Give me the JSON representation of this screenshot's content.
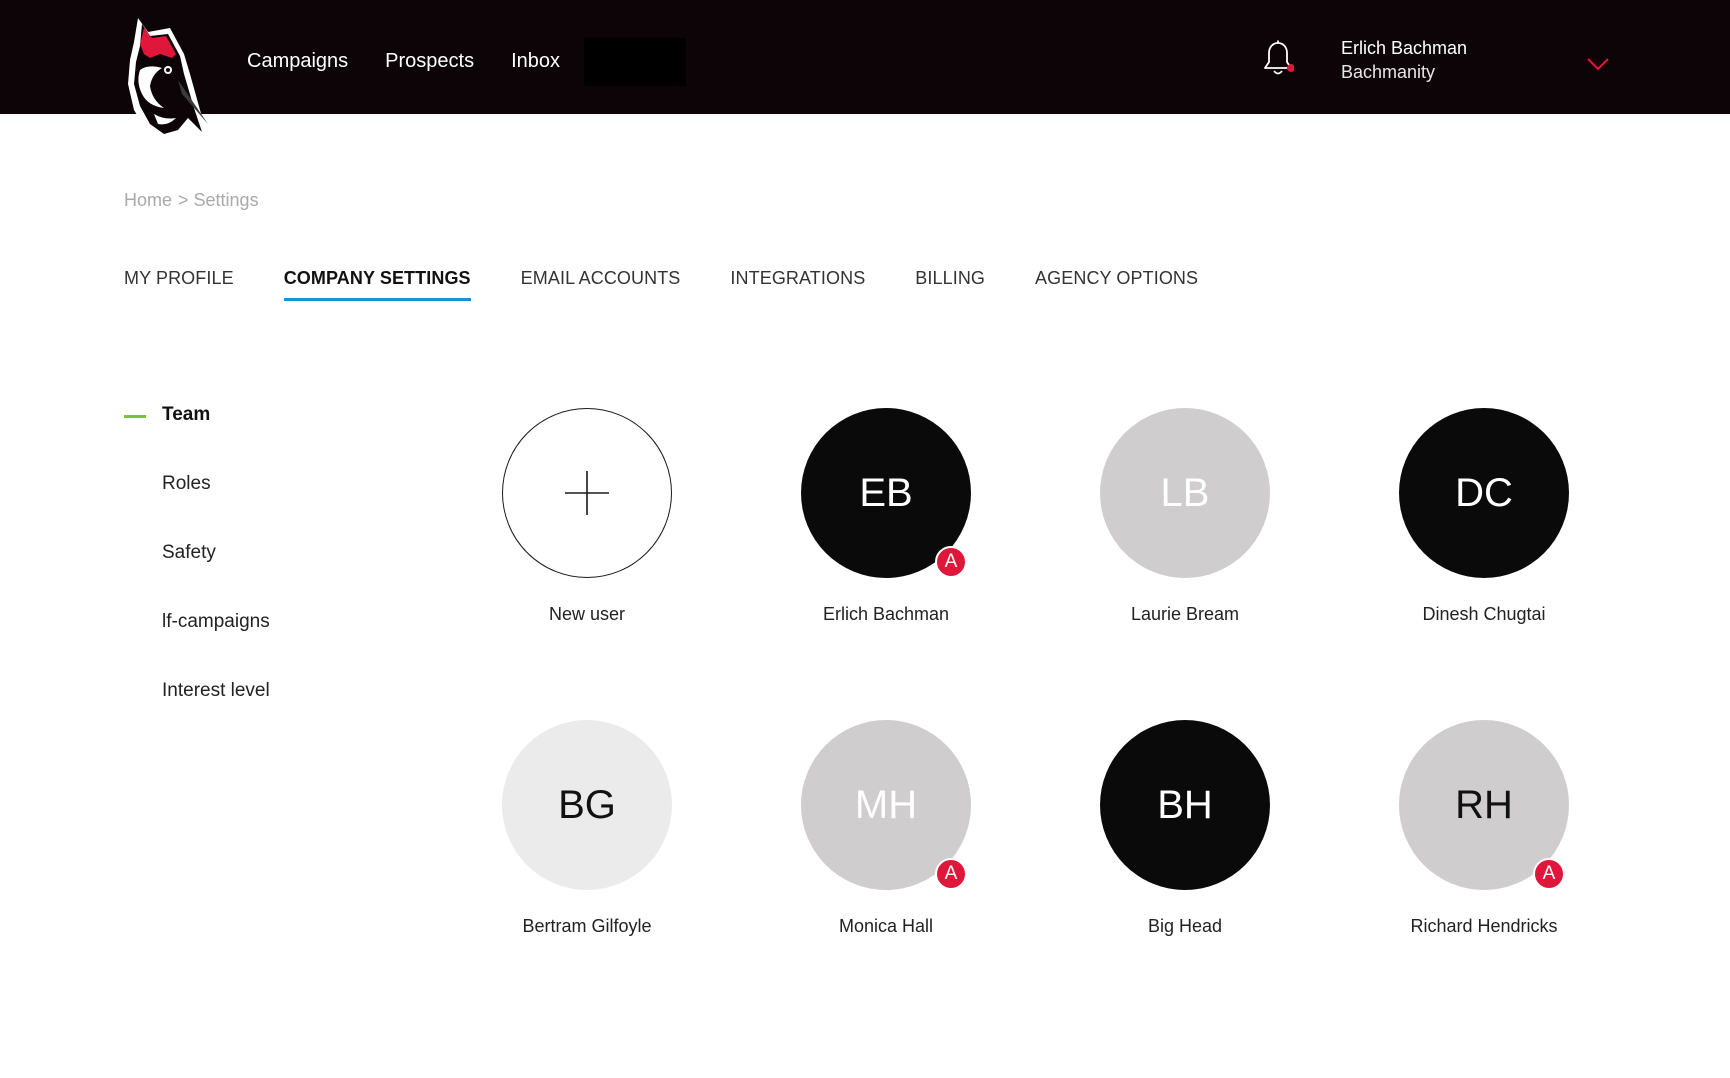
{
  "header": {
    "nav": [
      "Campaigns",
      "Prospects",
      "Inbox"
    ],
    "user_name": "Erlich Bachman",
    "user_org": "Bachmanity"
  },
  "breadcrumb": [
    "Home",
    "> Settings"
  ],
  "tabs": [
    {
      "label": "MY PROFILE",
      "active": false
    },
    {
      "label": "COMPANY SETTINGS",
      "active": true
    },
    {
      "label": "EMAIL ACCOUNTS",
      "active": false
    },
    {
      "label": "INTEGRATIONS",
      "active": false
    },
    {
      "label": "BILLING",
      "active": false
    },
    {
      "label": "AGENCY OPTIONS",
      "active": false
    }
  ],
  "sidebar": {
    "items": [
      {
        "label": "Team",
        "active": true
      },
      {
        "label": "Roles",
        "active": false
      },
      {
        "label": "Safety",
        "active": false
      },
      {
        "label": "lf-campaigns",
        "active": false
      },
      {
        "label": "Interest level",
        "active": false
      }
    ]
  },
  "team": {
    "new_user_label": "New user",
    "admin_badge": "A",
    "members": [
      {
        "initials": "EB",
        "name": "Erlich Bachman",
        "bg": "#0a0a0a",
        "fg": "#ffffff",
        "admin": true
      },
      {
        "initials": "LB",
        "name": "Laurie Bream",
        "bg": "#cfcdce",
        "fg": "#ffffff",
        "admin": false
      },
      {
        "initials": "DC",
        "name": "Dinesh Chugtai",
        "bg": "#0a0a0a",
        "fg": "#ffffff",
        "admin": false
      },
      {
        "initials": "BG",
        "name": "Bertram Gilfoyle",
        "bg": "#ebebeb",
        "fg": "#111111",
        "admin": false
      },
      {
        "initials": "MH",
        "name": "Monica Hall",
        "bg": "#cfcdce",
        "fg": "#ffffff",
        "admin": true
      },
      {
        "initials": "BH",
        "name": "Big Head",
        "bg": "#0a0a0a",
        "fg": "#ffffff",
        "admin": false
      },
      {
        "initials": "RH",
        "name": "Richard Hendricks",
        "bg": "#cfcdce",
        "fg": "#111111",
        "admin": true
      }
    ]
  },
  "colors": {
    "topbar": "#0c0406",
    "accent_tab": "#1c8fd6",
    "accent_sidebar": "#7dc13a",
    "admin_badge": "#e0173a"
  }
}
